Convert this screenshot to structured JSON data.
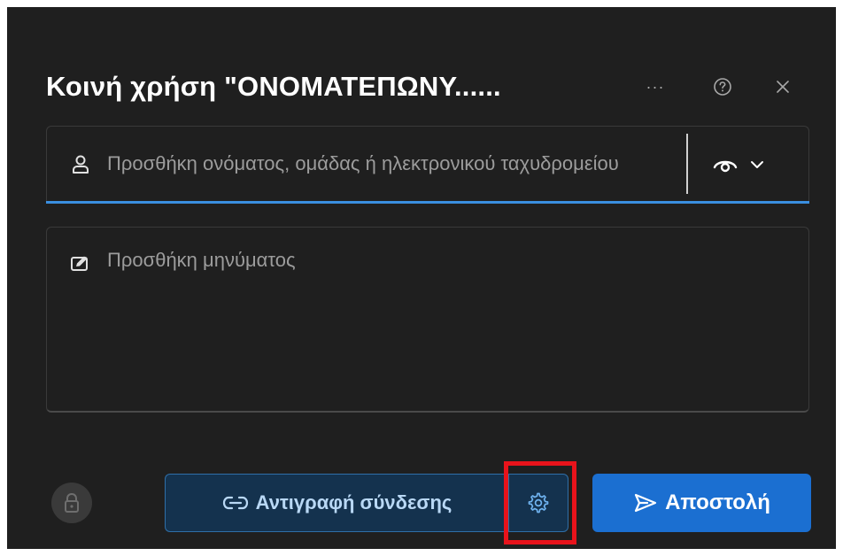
{
  "dialog": {
    "title": "Κοινή χρήση \"ΟΝΟΜΑΤΕΠΩΝΥ......",
    "header_icons": [
      "more-icon",
      "help-icon",
      "close-icon"
    ],
    "more_glyph": "···"
  },
  "recipients": {
    "placeholder": "Προσθήκη ονόματος, ομάδας ή ηλεκτρονικού ταχυδρομείου",
    "icon": "person-icon",
    "permission_icon": "eye-icon"
  },
  "message": {
    "placeholder": "Προσθήκη μηνύματος",
    "icon": "message-edit-icon"
  },
  "footer": {
    "lock_icon": "lock-icon",
    "copy_link_label": "Αντιγραφή σύνδεσης",
    "copy_link_icon": "link-icon",
    "settings_icon": "gear-icon",
    "send_label": "Αποστολή",
    "send_icon": "send-icon"
  },
  "colors": {
    "dialog_bg": "#1f1f1f",
    "accent": "#3a8fe0",
    "send_bg": "#1b6fd1",
    "highlight": "#e8131b"
  }
}
